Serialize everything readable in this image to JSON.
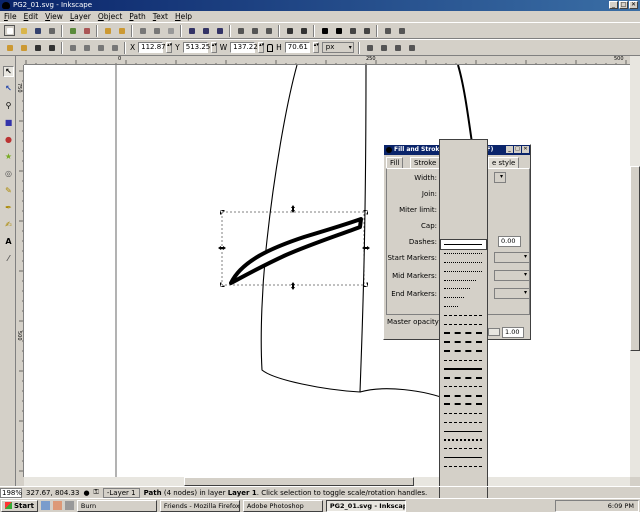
{
  "window": {
    "title": "PG2_01.svg - Inkscape",
    "controls": [
      "_",
      "□",
      "✕"
    ]
  },
  "menu": [
    "File",
    "Edit",
    "View",
    "Layer",
    "Object",
    "Path",
    "Text",
    "Help"
  ],
  "toolbar": {
    "x_label": "X",
    "x_value": "112.87",
    "y_label": "Y",
    "y_value": "513.25",
    "w_label": "W",
    "w_value": "137.22",
    "h_label": "H",
    "h_value": "70.61",
    "units": "px"
  },
  "rulers": {
    "h_labels": [
      "0",
      "250",
      "500"
    ],
    "v_labels": [
      "750",
      "500"
    ]
  },
  "fill_stroke": {
    "title": "Fill and Stroke (Shift+Ctrl+F)",
    "tab_fill": "Fill",
    "tab_stroke": "Stroke",
    "tab_style": "e style",
    "labels": {
      "width": "Width:",
      "join": "Join:",
      "miter": "Miter limit:",
      "cap": "Cap:",
      "dashes": "Dashes:",
      "start": "Start Markers:",
      "mid": "Mid Markers:",
      "end": "End Markers:"
    },
    "dash_offset": "0.00",
    "master_opacity_label": "Master opacity",
    "master_opacity_value": "1.00"
  },
  "statusbar": {
    "zoom": "198%",
    "cursor": "327.67, 804.33",
    "layer": "-Layer 1",
    "message_pre": "Path",
    "message_mid": " (4 nodes) in layer ",
    "message_layer": "Layer 1",
    "message_post": ". Click selection to toggle scale/rotation handles."
  },
  "taskbar": {
    "start": "Start",
    "tasks": [
      "Burn",
      "Friends - Mozilla Firefox",
      "Adobe Photoshop",
      "PG2_01.svg - Inkscape"
    ],
    "clock": "6:09 PM"
  }
}
